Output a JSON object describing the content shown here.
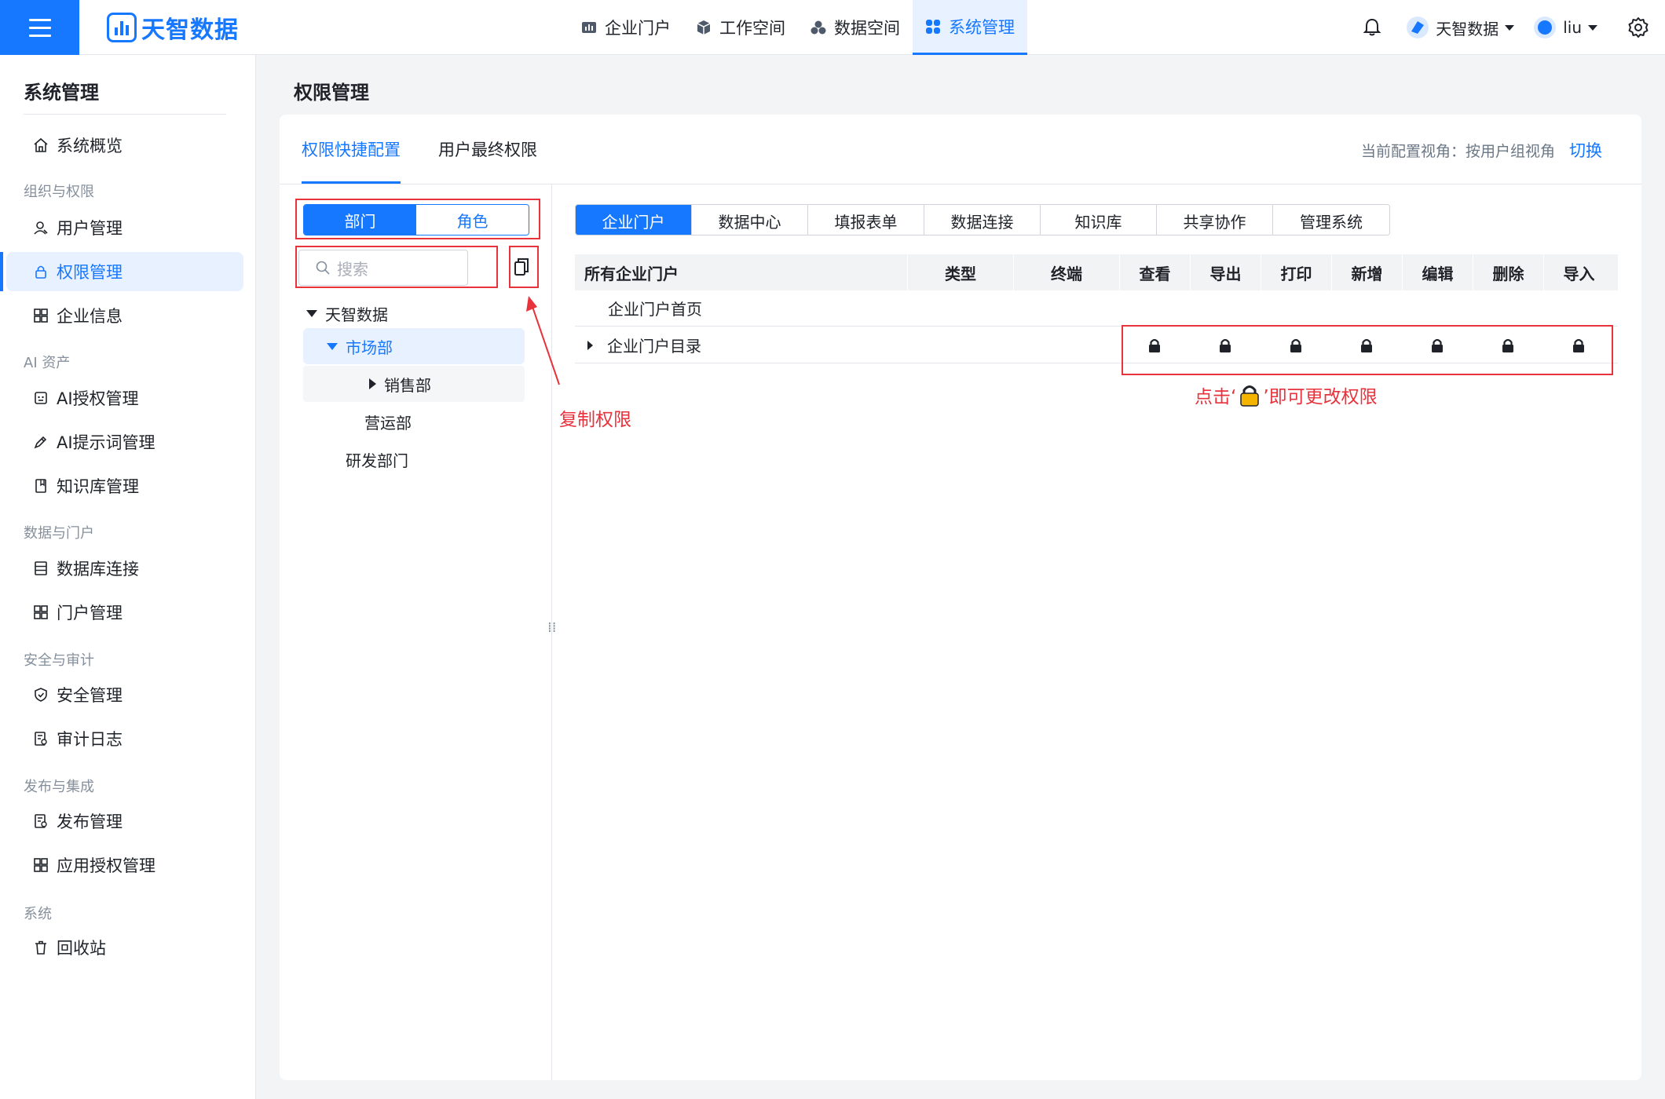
{
  "brand": {
    "name": "天智数据"
  },
  "topnav": [
    {
      "label": "企业门户",
      "icon": "chart-icon"
    },
    {
      "label": "工作空间",
      "icon": "cube-icon"
    },
    {
      "label": "数据空间",
      "icon": "cluster-icon"
    },
    {
      "label": "系统管理",
      "icon": "grid-icon",
      "active": true
    }
  ],
  "topright": {
    "org": "天智数据",
    "user": "liu"
  },
  "sidebar": {
    "title": "系统管理",
    "overview": "系统概览",
    "groups": {
      "org": "组织与权限",
      "ai": "AI 资产",
      "data": "数据与门户",
      "security": "安全与审计",
      "publish": "发布与集成",
      "system": "系统"
    },
    "items": {
      "user": "用户管理",
      "permission": "权限管理",
      "company": "企业信息",
      "ai_auth": "AI授权管理",
      "ai_prompt": "AI提示词管理",
      "kb": "知识库管理",
      "db": "数据库连接",
      "portal": "门户管理",
      "security": "安全管理",
      "audit": "审计日志",
      "publish": "发布管理",
      "app_auth": "应用授权管理",
      "recycle": "回收站"
    }
  },
  "page": {
    "title": "权限管理",
    "tabs": [
      "权限快捷配置",
      "用户最终权限"
    ],
    "view_label": "当前配置视角：按用户组视角",
    "switch_label": "切换"
  },
  "left": {
    "seg": [
      "部门",
      "角色"
    ],
    "search_placeholder": "搜索",
    "tree": [
      "天智数据",
      "市场部",
      "销售部",
      "营运部",
      "研发部门"
    ]
  },
  "categories": [
    "企业门户",
    "数据中心",
    "填报表单",
    "数据连接",
    "知识库",
    "共享协作",
    "管理系统"
  ],
  "table": {
    "headers": [
      "所有企业门户",
      "类型",
      "终端",
      "查看",
      "导出",
      "打印",
      "新增",
      "编辑",
      "删除",
      "导入"
    ],
    "rows": [
      "企业门户首页",
      "企业门户目录"
    ]
  },
  "annotations": {
    "copy": "复制权限",
    "lock_prefix": "点击‘",
    "lock_suffix": "’即可更改权限"
  },
  "colors": {
    "accent": "#1677ff",
    "annotation": "#e8323c"
  }
}
